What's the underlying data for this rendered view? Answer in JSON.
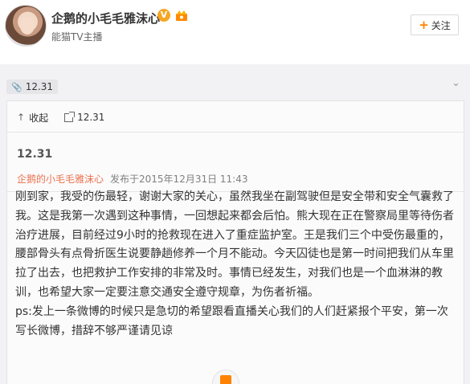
{
  "header": {
    "name": "企鹅的小毛毛雅沫心",
    "verify": "能猫TV主播",
    "follow_label": "关注",
    "follow_plus": "+",
    "vip_badge": "V"
  },
  "tag": {
    "label": "12.31"
  },
  "card": {
    "collapse_label": "收起",
    "link_label": "12.31",
    "title": "12.31",
    "author": "企鹅的小毛毛雅沫心",
    "date": "发布于2015年12月31日 11:43",
    "paragraphs": [
      "刚到家，我受的伤最轻，谢谢大家的关心，虽然我坐在副驾驶但是安全带和安全气囊救了我。这是我第一次遇到这种事情，一回想起来都会后怕。熊大现在正在警察局里等待伤者治疗进展，目前经过9小时的抢救现在进入了重症监护室。王是我们三个中受伤最重的，腰部骨头有点骨折医生说要静趟修养一个月不能动。今天囚徒也是第一时间把我们从车里拉了出去，也把救护工作安排的非常及时。事情已经发生，对我们也是一个血淋淋的教训，也希望大家一定要注意交通安全遵守规章，为伤者祈福。",
      "ps:发上一条微博的时候只是急切的希望跟看直播关心我们的人们赶紧报个平安，第一次写长微博，措辞不够严谨请见谅"
    ]
  },
  "colors": {
    "accent": "#eb7350",
    "follow_plus": "#ff8200",
    "background": "#f2f2f5"
  }
}
